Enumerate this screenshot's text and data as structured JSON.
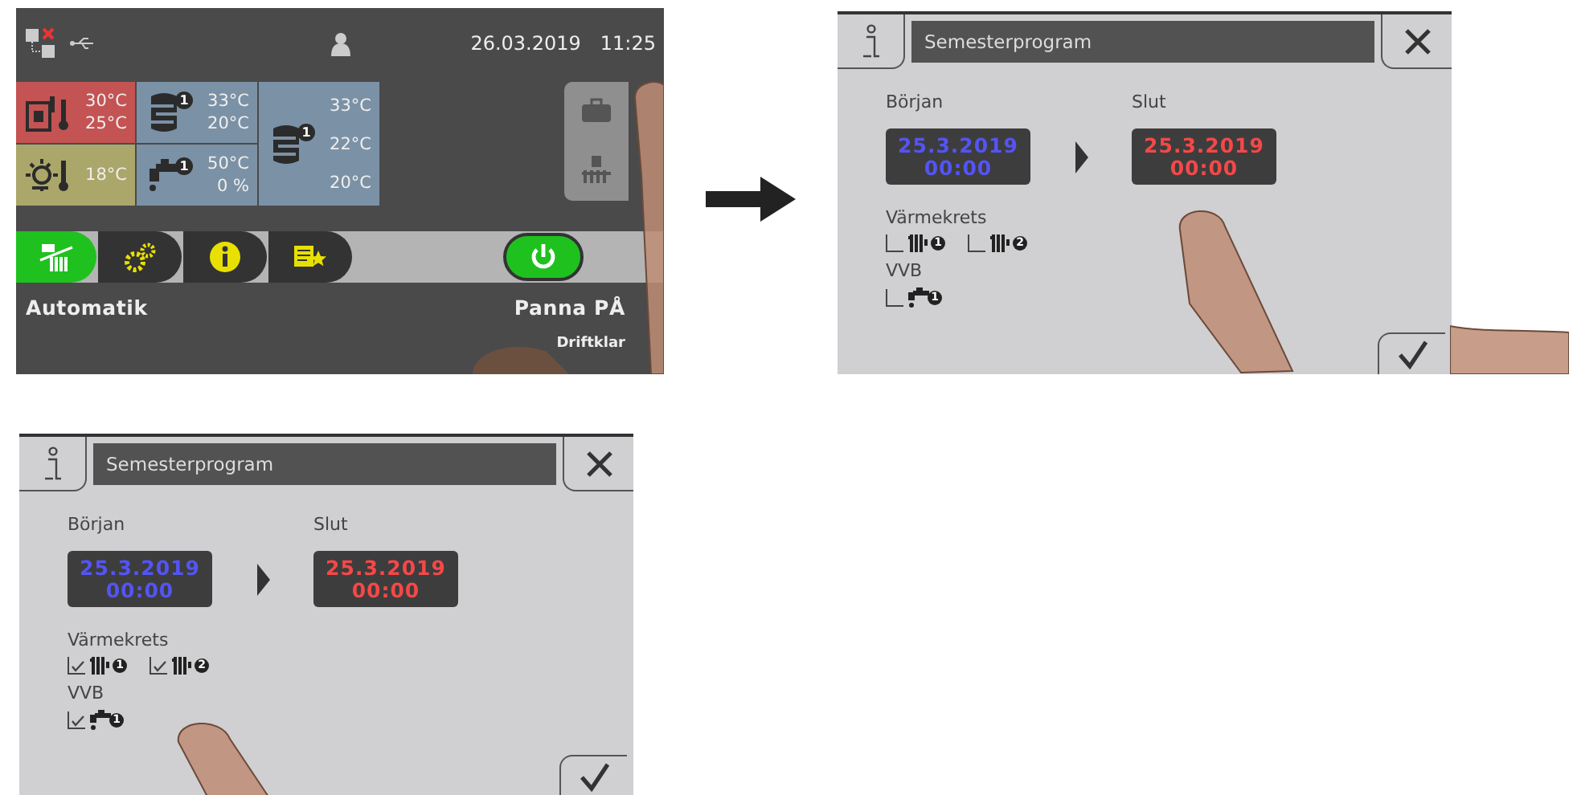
{
  "screens": [
    {
      "kind": "main",
      "top_bar": {
        "date": "26.03.2019",
        "time": "11:25"
      },
      "tiles": [
        {
          "kind": "boiler",
          "color": "#c45353",
          "readings": [
            "30°C",
            "25°C"
          ]
        },
        {
          "kind": "buffer",
          "color": "#7b91a6",
          "badge": "1",
          "readings": [
            "33°C",
            "20°C"
          ]
        },
        {
          "kind": "storage",
          "color": "#7b91a6",
          "badge": "1",
          "readings": [
            "33°C",
            "22°C",
            "20°C"
          ]
        },
        {
          "kind": "outdoor",
          "color": "#aba66a",
          "readings": [
            "18°C"
          ]
        },
        {
          "kind": "hot-water",
          "color": "#7b91a6",
          "badge": "1",
          "readings": [
            "50°C",
            "0 %"
          ]
        }
      ],
      "side_buttons": [
        {
          "kind": "suitcase"
        },
        {
          "kind": "radiator"
        }
      ],
      "nav_tabs": [
        {
          "kind": "heating",
          "selected": true
        },
        {
          "kind": "settings",
          "selected": false
        },
        {
          "kind": "info",
          "selected": false
        },
        {
          "kind": "favorites",
          "selected": false
        }
      ],
      "power": {
        "on": true
      },
      "mode": "Automatik",
      "boiler_state": "Panna PÅ",
      "status": "Driftklar",
      "fingers": [
        {
          "kind": "side-button"
        },
        {
          "kind": "bottom"
        }
      ]
    },
    {
      "kind": "vacation",
      "title": "Semesterprogram",
      "periods": [
        {
          "label": "Början",
          "date": "25.3.2019",
          "time": "00:00",
          "color": "#5454f5"
        },
        {
          "label": "Slut",
          "date": "25.3.2019",
          "time": "00:00",
          "color": "#f54848"
        }
      ],
      "groups": [
        {
          "label": "Värmekrets",
          "items": [
            {
              "kind": "heating-circuit",
              "badge": "1",
              "checked": false
            },
            {
              "kind": "heating-circuit",
              "badge": "2",
              "checked": false
            }
          ]
        },
        {
          "label": "VVB",
          "items": [
            {
              "kind": "hot-water",
              "badge": "1",
              "checked": false
            }
          ]
        }
      ],
      "fingers": [
        {
          "kind": "end-date"
        },
        {
          "kind": "confirm"
        }
      ]
    },
    {
      "kind": "vacation",
      "title": "Semesterprogram",
      "periods": [
        {
          "label": "Början",
          "date": "25.3.2019",
          "time": "00:00",
          "color": "#5454f5"
        },
        {
          "label": "Slut",
          "date": "25.3.2019",
          "time": "00:00",
          "color": "#f54848"
        }
      ],
      "groups": [
        {
          "label": "Värmekrets",
          "items": [
            {
              "kind": "heating-circuit",
              "badge": "1",
              "checked": true
            },
            {
              "kind": "heating-circuit",
              "badge": "2",
              "checked": true
            }
          ]
        },
        {
          "label": "VVB",
          "items": [
            {
              "kind": "hot-water",
              "badge": "1",
              "checked": true
            }
          ]
        }
      ],
      "fingers": [
        {
          "kind": "circuit"
        }
      ]
    }
  ]
}
